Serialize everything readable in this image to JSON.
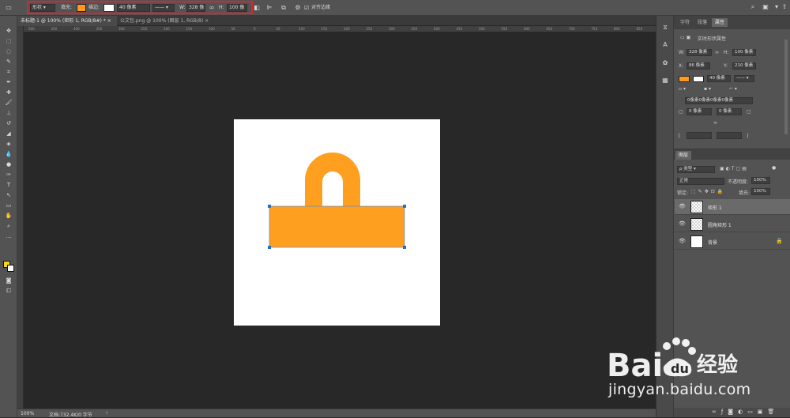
{
  "options_bar": {
    "shape_mode": "形状",
    "fill_label": "填充:",
    "stroke_label": "描边:",
    "stroke_width": "40 像素",
    "w_label": "W:",
    "w_value": "328 像",
    "link_icon": "link-icon",
    "h_label": "H:",
    "h_value": "100 像",
    "align_edges_label": "对齐边缘",
    "fill_color": "#ff9a1f",
    "highlight_color": "#e0222a"
  },
  "tabs": [
    {
      "label": "未标题-1 @ 100% (矩形 1, RGB/8#) *",
      "close": "×"
    },
    {
      "label": "公文包.png @ 100% (图层 1, RGB/8)",
      "close": "×"
    }
  ],
  "ruler_ticks": [
    "500",
    "450",
    "400",
    "350",
    "300",
    "250",
    "200",
    "150",
    "100",
    "50",
    "0",
    "50",
    "100",
    "150",
    "200",
    "250",
    "300",
    "350",
    "400",
    "450",
    "500",
    "550",
    "600",
    "650",
    "700",
    "750",
    "800",
    "850"
  ],
  "canvas": {
    "shape_color": "#ff9f1f",
    "handle_color": "#2a6fbf"
  },
  "status": {
    "zoom": "100%",
    "doc_info": "文档:732.4K/0 字节"
  },
  "properties_panel": {
    "tabs": [
      "字符",
      "段落",
      "属性"
    ],
    "title": "实时形状属性",
    "w_label": "W:",
    "w_value": "328 像素",
    "h_label": "H:",
    "h_value": "100 像素",
    "x_label": "X:",
    "x_value": "86 像素",
    "y_label": "Y:",
    "y_value": "210 像素",
    "stroke_width": "40 像素",
    "corner_all": "0像素0像素0像素0像素",
    "corner_tl": "0 像素",
    "corner_tr": "0 像素"
  },
  "layers_panel": {
    "title": "图层",
    "filter_label": "ρ 类型",
    "blend_mode": "正常",
    "opacity_label": "不透明度:",
    "opacity_value": "100%",
    "lock_label": "锁定:",
    "fill_label": "填充:",
    "fill_value": "100%",
    "layers": [
      {
        "name": "矩形 1",
        "selected": true
      },
      {
        "name": "圆角矩形 1",
        "selected": false
      },
      {
        "name": "背景",
        "selected": false
      }
    ]
  },
  "watermark": {
    "brand_text": "Bai",
    "brand_suffix": "经验",
    "url": "jingyan.baidu.com"
  }
}
